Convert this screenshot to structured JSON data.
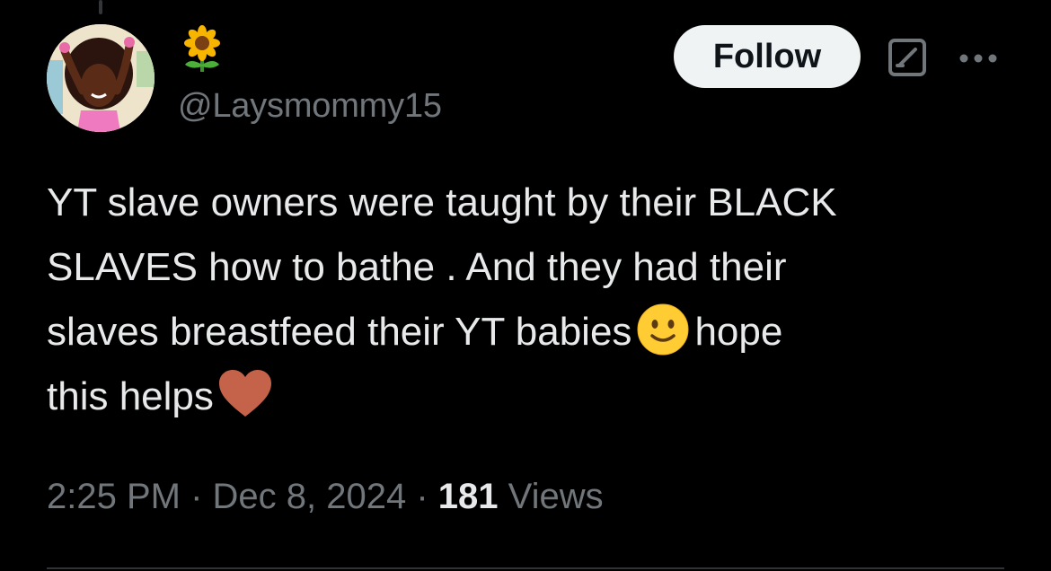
{
  "author": {
    "display_name_icon": "sunflower-emoji",
    "handle": "@Laysmommy15",
    "avatar_icon": "cartoon-avatar"
  },
  "header": {
    "follow_label": "Follow",
    "grok_icon": "grok-icon",
    "more_icon": "more-dots-icon"
  },
  "tweet": {
    "line1": "YT slave owners were taught by their BLACK",
    "line2": "SLAVES how to bathe . And they had their",
    "line3_a": "slaves breastfeed their YT babies",
    "line3_b": "hope",
    "line4": "this helps",
    "emoji_1": "slightly-smiling-face-emoji",
    "emoji_2": "brown-heart-emoji"
  },
  "meta": {
    "time": "2:25 PM",
    "sep1": " · ",
    "date": "Dec 8, 2024",
    "sep2": " · ",
    "views_count": "181",
    "views_label": " Views"
  },
  "colors": {
    "background": "#000000",
    "text_primary": "#e7e9ea",
    "text_secondary": "#71767b",
    "follow_bg": "#eff3f4",
    "follow_text": "#0f1419",
    "divider": "#2f3336"
  }
}
